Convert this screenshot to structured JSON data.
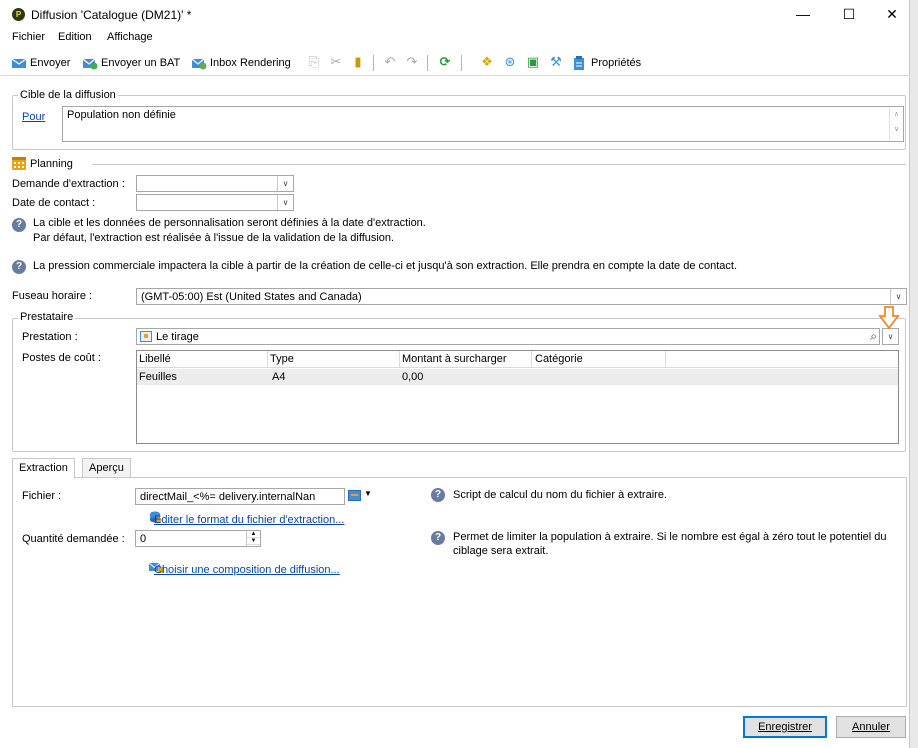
{
  "window": {
    "title": "Diffusion 'Catalogue (DM21)' *",
    "controls": {
      "minimize": "—",
      "maximize": "☐",
      "close": "✕"
    }
  },
  "menu": [
    "Fichier",
    "Edition",
    "Affichage"
  ],
  "toolbar": {
    "send": "Envoyer",
    "send_bat": "Envoyer un BAT",
    "inbox_rendering": "Inbox Rendering",
    "properties": "Propriétés"
  },
  "target": {
    "group_label": "Cible de la diffusion",
    "link": "Pour",
    "value": "Population non définie"
  },
  "planning": {
    "group_label": "Planning",
    "extraction_label": "Demande d'extraction :",
    "extraction_value": "",
    "contact_label": "Date de contact :",
    "contact_value": "",
    "info_line1": "La cible et les données de personnalisation seront définies à la date d'extraction.",
    "info_line2": "Par défaut, l'extraction est réalisée à l'issue de la validation de la diffusion.",
    "pressure_info": "La pression commerciale impactera la cible à partir de la création de celle-ci et jusqu'à son extraction. Elle prendra en compte la date de contact."
  },
  "timezone": {
    "label": "Fuseau horaire :",
    "value": "(GMT-05:00) Est (United States and Canada)"
  },
  "provider": {
    "group_label": "Prestataire",
    "service_label": "Prestation :",
    "service_value": "Le tirage",
    "costs_label": "Postes de coût :",
    "columns": [
      "Libellé",
      "Type",
      "Montant à surcharger",
      "Catégorie"
    ],
    "rows": [
      {
        "label": "Feuilles",
        "type": "A4",
        "amount": "0,00",
        "category": ""
      }
    ]
  },
  "tabs": {
    "extraction": "Extraction",
    "preview": "Aperçu"
  },
  "extraction": {
    "file_label": "Fichier :",
    "file_value": "directMail_<%= delivery.internalNan",
    "edit_format_link": "Editer le format du fichier d'extraction...",
    "quantity_label": "Quantité demandée :",
    "quantity_value": "0",
    "composition_link": "Choisir une composition de diffusion...",
    "file_help": "Script de calcul du nom du fichier à extraire.",
    "quantity_help_line1": "Permet de limiter la population à extraire. Si le nombre est égal à zéro tout le potentiel du",
    "quantity_help_line2": "ciblage sera extrait."
  },
  "buttons": {
    "save": "Enregistrer",
    "cancel": "Annuler"
  },
  "colors": {
    "accent": "#0078d7",
    "link": "#0645ad",
    "highlight_arrow": "#f08a24"
  }
}
